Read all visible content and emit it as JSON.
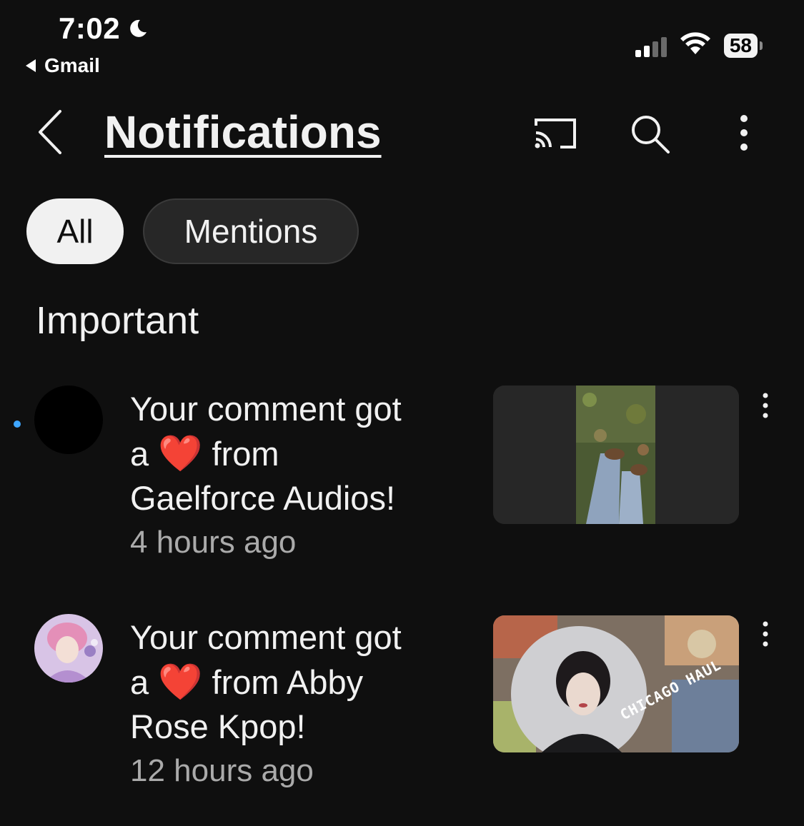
{
  "status_bar": {
    "time": "7:02",
    "back_app": "Gmail",
    "battery": "58"
  },
  "header": {
    "title": "Notifications"
  },
  "chips": [
    {
      "label": "All",
      "selected": true
    },
    {
      "label": "Mentions",
      "selected": false
    }
  ],
  "section": {
    "label": "Important"
  },
  "notifications": [
    {
      "line1": "Your comment got",
      "prefix": "a",
      "heart": "❤️",
      "after_heart": "from",
      "line3": "Gaelforce Audios!",
      "time": "4 hours ago",
      "unread": true
    },
    {
      "line1": "Your comment got",
      "prefix": "a",
      "heart": "❤️",
      "after_heart": "from Abby",
      "line3": "Rose Kpop!",
      "time": "12 hours ago",
      "unread": false,
      "thumb_caption": "CHICAGO HAUL"
    }
  ],
  "colors": {
    "background": "#0f0f0f",
    "chip_selected": "#f1f1f1",
    "chip_default": "#272727",
    "unread_dot": "#3ea6ff",
    "secondary_text": "#aaaaaa"
  }
}
